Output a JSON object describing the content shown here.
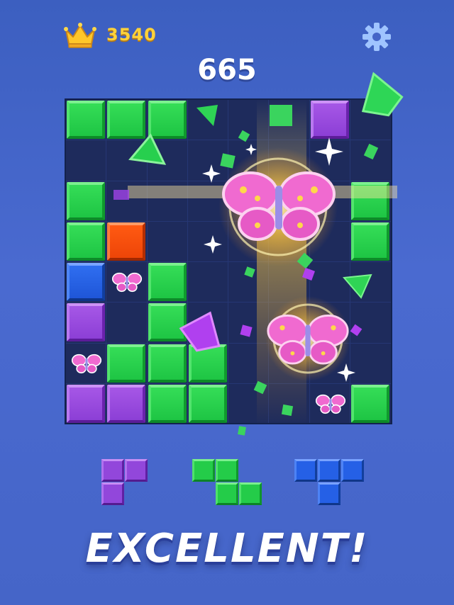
{
  "hud": {
    "best_score": "3540",
    "score": "665",
    "crown_icon": "crown-icon",
    "settings_icon": "gear-icon"
  },
  "colors": {
    "green": "#22cc48",
    "purple": "#9447dc",
    "orange": "#f24a0a",
    "blue": "#2462e8",
    "board_bg": "#1e2b5c",
    "accent_gold": "#ffd23a"
  },
  "board": {
    "size": 8,
    "cells": [
      [
        "green",
        "green",
        "green",
        "",
        "",
        "",
        "purple",
        ""
      ],
      [
        "",
        "",
        "",
        "",
        "",
        "",
        "",
        ""
      ],
      [
        "green",
        "",
        "",
        "",
        "",
        "",
        "",
        "green"
      ],
      [
        "green",
        "orange",
        "",
        "",
        "",
        "",
        "",
        "green"
      ],
      [
        "blue",
        "butterfly",
        "green",
        "",
        "",
        "",
        "",
        ""
      ],
      [
        "purple",
        "",
        "green",
        "",
        "",
        "",
        "",
        ""
      ],
      [
        "butterfly",
        "green",
        "green",
        "green",
        "",
        "",
        "",
        ""
      ],
      [
        "purple",
        "purple",
        "green",
        "green",
        "",
        "",
        "butterfly",
        "green"
      ]
    ]
  },
  "pieces": [
    {
      "color": "purple",
      "cells": [
        [
          0,
          0
        ],
        [
          1,
          0
        ],
        [
          0,
          1
        ]
      ]
    },
    {
      "color": "green",
      "cells": [
        [
          0,
          0
        ],
        [
          1,
          0
        ],
        [
          1,
          1
        ],
        [
          2,
          1
        ]
      ]
    },
    {
      "color": "blue",
      "cells": [
        [
          0,
          0
        ],
        [
          1,
          0
        ],
        [
          2,
          0
        ],
        [
          1,
          1
        ]
      ]
    }
  ],
  "banner": {
    "text": "EXCELLENT!"
  }
}
